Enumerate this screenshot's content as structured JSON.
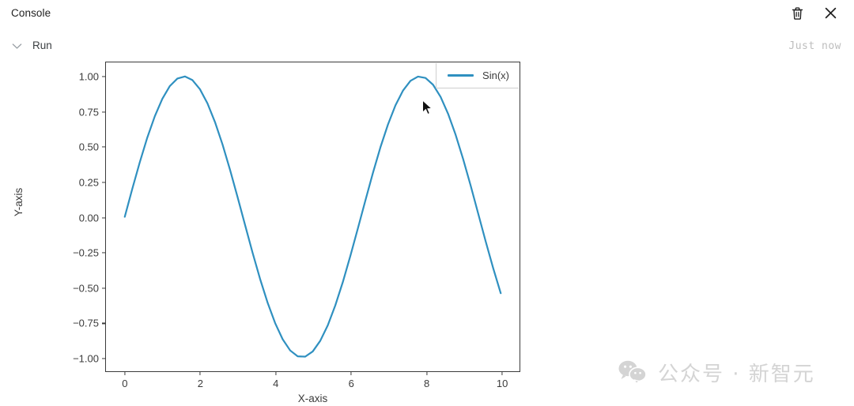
{
  "header": {
    "title": "Console",
    "delete_icon": "trash-icon",
    "close_icon": "close-icon"
  },
  "run_row": {
    "chevron_icon": "chevron-down-icon",
    "label": "Run",
    "timestamp": "Just now"
  },
  "watermark": {
    "icon": "wechat-icon",
    "text": "公众号 · 新智元"
  },
  "colors": {
    "line": "#2f90c0",
    "axis": "#3b3b3b",
    "legend_border": "#cfcfcf",
    "timestamp": "#bdbdbd",
    "watermark": "#d4d4d4"
  },
  "chart_data": {
    "type": "line",
    "title": "",
    "xlabel": "X-axis",
    "ylabel": "Y-axis",
    "xlim": [
      -0.5,
      10.5
    ],
    "ylim": [
      -1.1,
      1.1
    ],
    "grid": false,
    "legend_position": "upper right",
    "xticks": [
      0,
      2,
      4,
      6,
      8,
      10
    ],
    "xticklabels": [
      "0",
      "2",
      "4",
      "6",
      "8",
      "10"
    ],
    "yticks": [
      -1.0,
      -0.75,
      -0.5,
      -0.25,
      0.0,
      0.25,
      0.5,
      0.75,
      1.0
    ],
    "yticklabels": [
      "−1.00",
      "−0.75",
      "−0.50",
      "−0.25",
      "0.00",
      "0.25",
      "0.50",
      "0.75",
      "1.00"
    ],
    "series": [
      {
        "name": "Sin(x)",
        "color": "#2f90c0",
        "linewidth": 2.2,
        "formula": "sin(x)",
        "x": [
          0.0,
          0.2,
          0.4,
          0.6,
          0.8,
          1.0,
          1.2,
          1.4,
          1.6,
          1.8,
          2.0,
          2.2,
          2.4,
          2.6,
          2.8,
          3.0,
          3.2,
          3.4,
          3.6,
          3.8,
          4.0,
          4.2,
          4.4,
          4.6,
          4.8,
          5.0,
          5.2,
          5.4,
          5.6,
          5.8,
          6.0,
          6.2,
          6.4,
          6.6,
          6.8,
          7.0,
          7.2,
          7.4,
          7.6,
          7.8,
          8.0,
          8.2,
          8.4,
          8.6,
          8.8,
          9.0,
          9.2,
          9.4,
          9.6,
          9.8,
          10.0
        ],
        "y": [
          0.0,
          0.199,
          0.389,
          0.565,
          0.717,
          0.841,
          0.932,
          0.985,
          1.0,
          0.974,
          0.909,
          0.808,
          0.675,
          0.516,
          0.335,
          0.141,
          -0.058,
          -0.256,
          -0.443,
          -0.612,
          -0.757,
          -0.872,
          -0.952,
          -0.994,
          -0.996,
          -0.959,
          -0.883,
          -0.773,
          -0.631,
          -0.465,
          -0.279,
          -0.083,
          0.116,
          0.312,
          0.495,
          0.657,
          0.794,
          0.899,
          0.969,
          0.999,
          0.989,
          0.941,
          0.855,
          0.734,
          0.585,
          0.412,
          0.223,
          0.024,
          -0.175,
          -0.366,
          -0.544
        ]
      }
    ]
  }
}
